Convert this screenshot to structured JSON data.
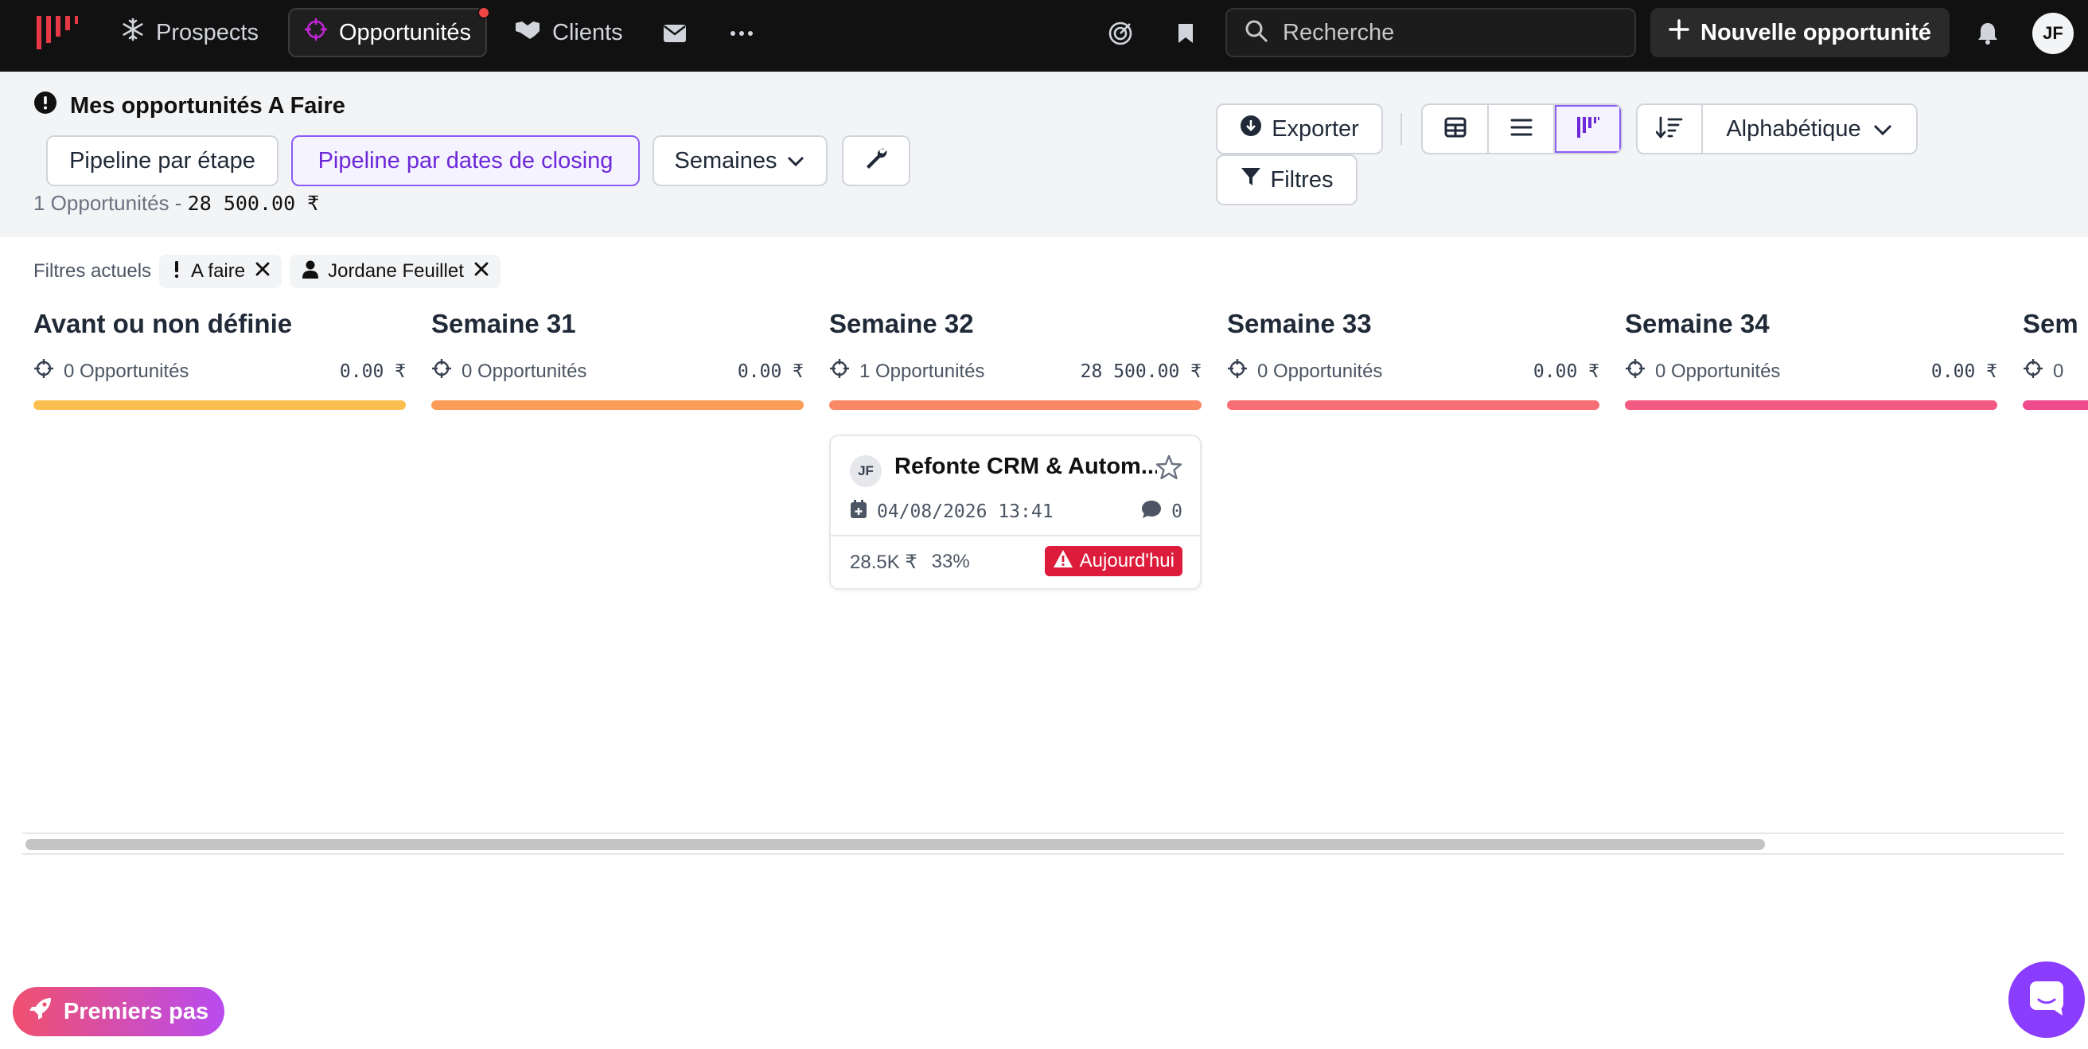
{
  "nav": {
    "items": [
      {
        "label": "Prospects",
        "icon": "snowflake-icon"
      },
      {
        "label": "Opportunités",
        "icon": "target-icon",
        "active": true,
        "has_notification": true
      },
      {
        "label": "Clients",
        "icon": "handshake-icon"
      }
    ],
    "search_placeholder": "Recherche",
    "new_button_label": "Nouvelle opportunité",
    "user_initials": "JF"
  },
  "header": {
    "title": "Mes opportunités A Faire",
    "pipeline_stage_label": "Pipeline par étape",
    "pipeline_dates_label": "Pipeline par dates de closing",
    "period_label": "Semaines",
    "summary_count": "1 Opportunités -",
    "summary_amount": "28 500.00 ₹",
    "export_label": "Exporter",
    "filters_label": "Filtres",
    "sort_label": "Alphabétique"
  },
  "current_filters": {
    "label": "Filtres actuels",
    "chips": [
      {
        "label": "A faire",
        "icon": "exclamation-icon"
      },
      {
        "label": "Jordane Feuillet",
        "icon": "user-icon"
      }
    ]
  },
  "columns": [
    {
      "title": "Avant ou non définie",
      "count": "0 Opportunités",
      "amount": "0.00 ₹",
      "color": "#fbbf4f"
    },
    {
      "title": "Semaine 31",
      "count": "0 Opportunités",
      "amount": "0.00 ₹",
      "color": "#fb9c58"
    },
    {
      "title": "Semaine 32",
      "count": "1 Opportunités",
      "amount": "28 500.00 ₹",
      "color": "#f98866"
    },
    {
      "title": "Semaine 33",
      "count": "0 Opportunités",
      "amount": "0.00 ₹",
      "color": "#f76f74"
    },
    {
      "title": "Semaine 34",
      "count": "0 Opportunités",
      "amount": "0.00 ₹",
      "color": "#f25a82"
    },
    {
      "title": "Sem",
      "count": "0",
      "amount": "",
      "color": "#ee4a8c"
    }
  ],
  "card": {
    "initials": "JF",
    "title": "Refonte CRM & Autom...",
    "date": "04/08/2026 13:41",
    "comments": "0",
    "amount": "28.5K ₹",
    "probability": "33%",
    "badge": "Aujourd'hui"
  },
  "onboarding_label": "Premiers pas",
  "colors": {
    "accent": "#8b5cf6",
    "danger": "#dc1c3a",
    "nav_bg": "#111111"
  }
}
